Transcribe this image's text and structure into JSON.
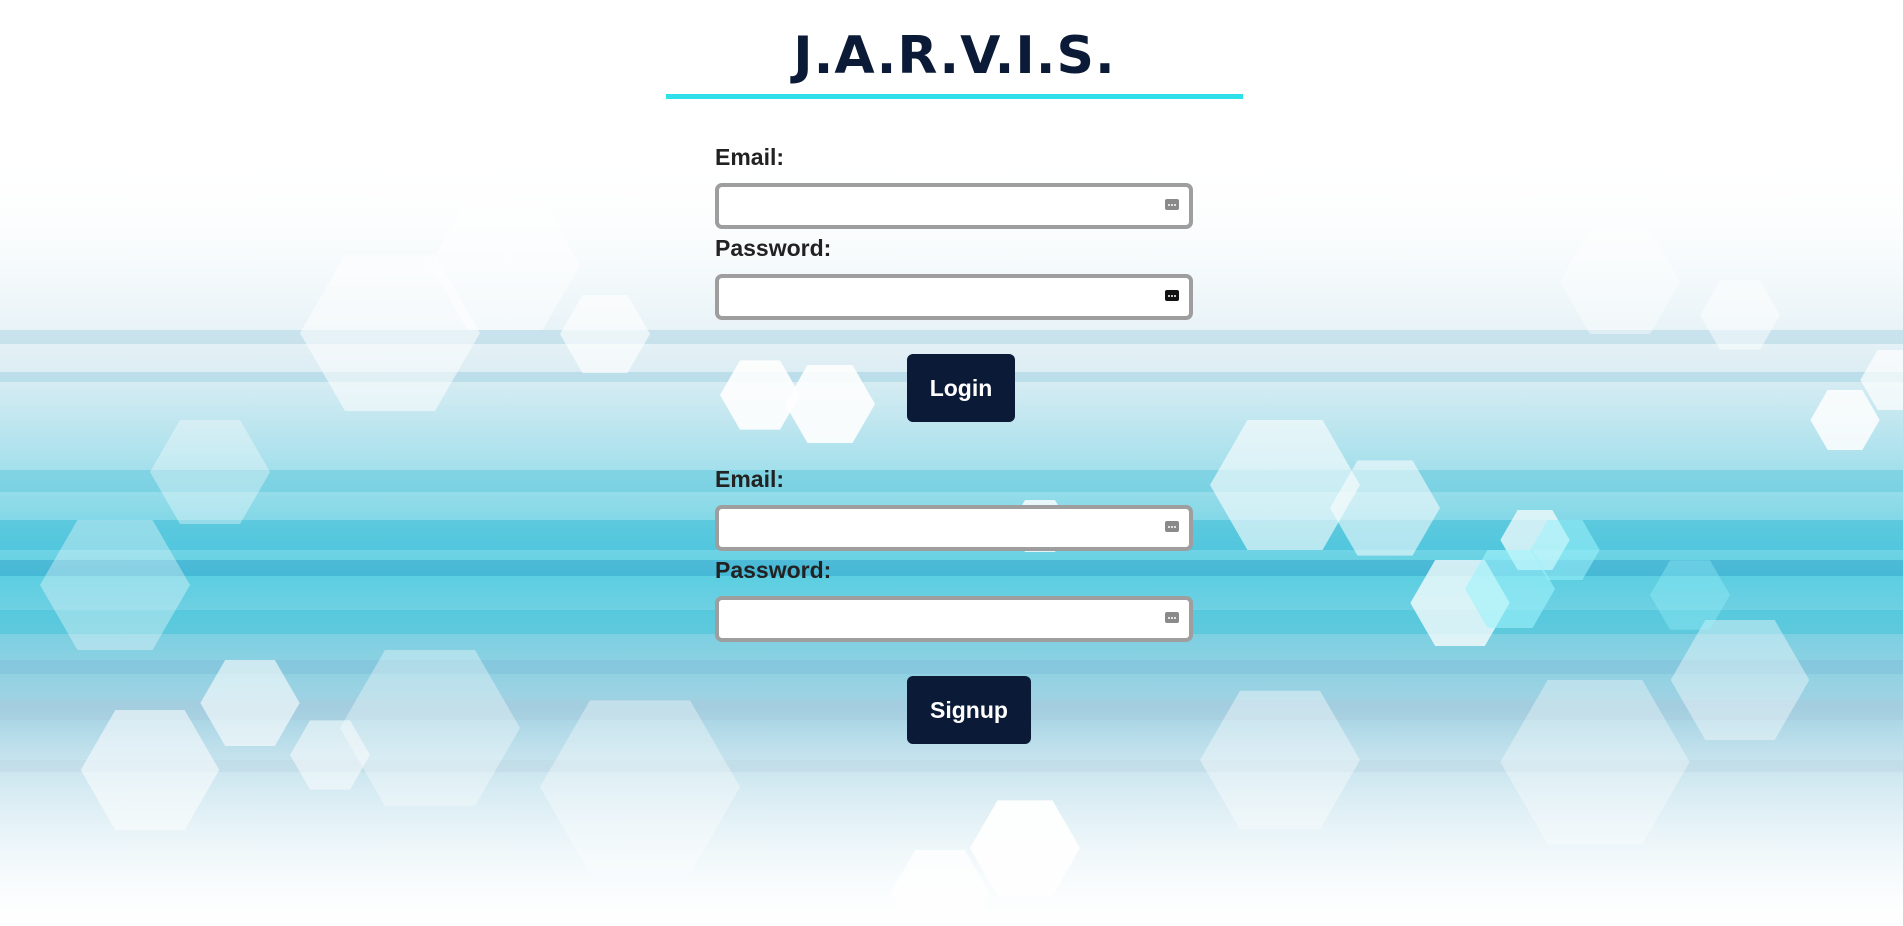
{
  "app": {
    "title": "J.A.R.V.I.S."
  },
  "login_form": {
    "email_label": "Email:",
    "email_value": "",
    "password_label": "Password:",
    "password_value": "",
    "submit_label": "Login"
  },
  "signup_form": {
    "email_label": "Email:",
    "email_value": "",
    "password_label": "Password:",
    "password_value": "",
    "submit_label": "Signup"
  },
  "icons": {
    "field_autofill": "password-manager-key-icon"
  },
  "colors": {
    "title": "#0b1a36",
    "accent_rule": "#2ee0e8",
    "button_bg": "#0b1a36",
    "button_text": "#ffffff",
    "input_border": "#9e9e9e"
  }
}
